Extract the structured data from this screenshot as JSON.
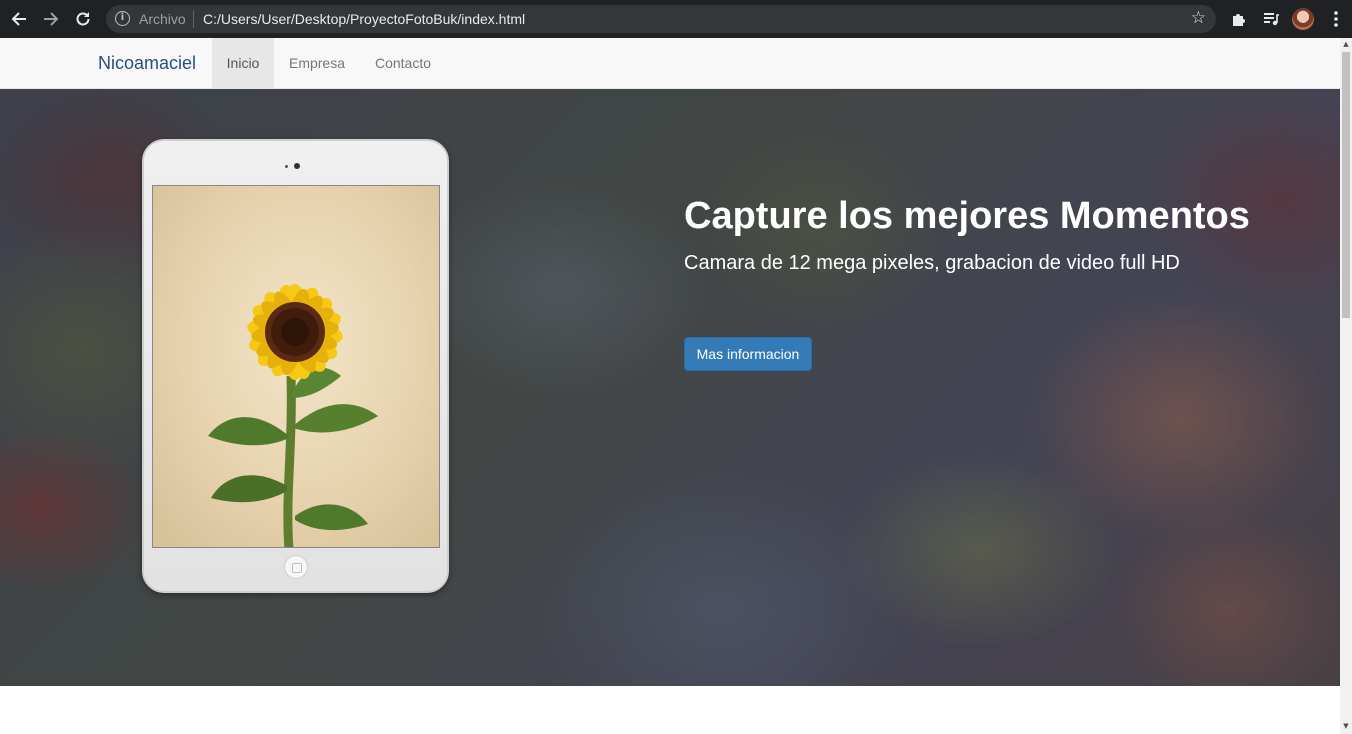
{
  "browser": {
    "back_icon": "arrow-left-icon",
    "forward_icon": "arrow-right-icon",
    "reload_icon": "reload-icon",
    "info_icon": "info-icon",
    "info_glyph": "i",
    "scheme_label": "Archivo",
    "url": "C:/Users/User/Desktop/ProyectoFotoBuk/index.html",
    "bookmark_icon": "star-icon",
    "extensions_icon": "puzzle-icon",
    "media_icon": "playlist-icon",
    "menu_icon": "kebab-menu-icon"
  },
  "navbar": {
    "brand": "Nicoamaciel",
    "items": [
      {
        "label": "Inicio",
        "active": true
      },
      {
        "label": "Empresa",
        "active": false
      },
      {
        "label": "Contacto",
        "active": false
      }
    ]
  },
  "hero": {
    "title": "Capture los mejores Momentos",
    "subtitle": "Camara de 12 mega pixeles, grabacion de video full HD",
    "button_label": "Mas informacion",
    "button_color": "#337ab7"
  },
  "colors": {
    "brand": "#2a4c84",
    "navbar_bg": "#f8f8f8",
    "chrome_bg": "#202124"
  }
}
